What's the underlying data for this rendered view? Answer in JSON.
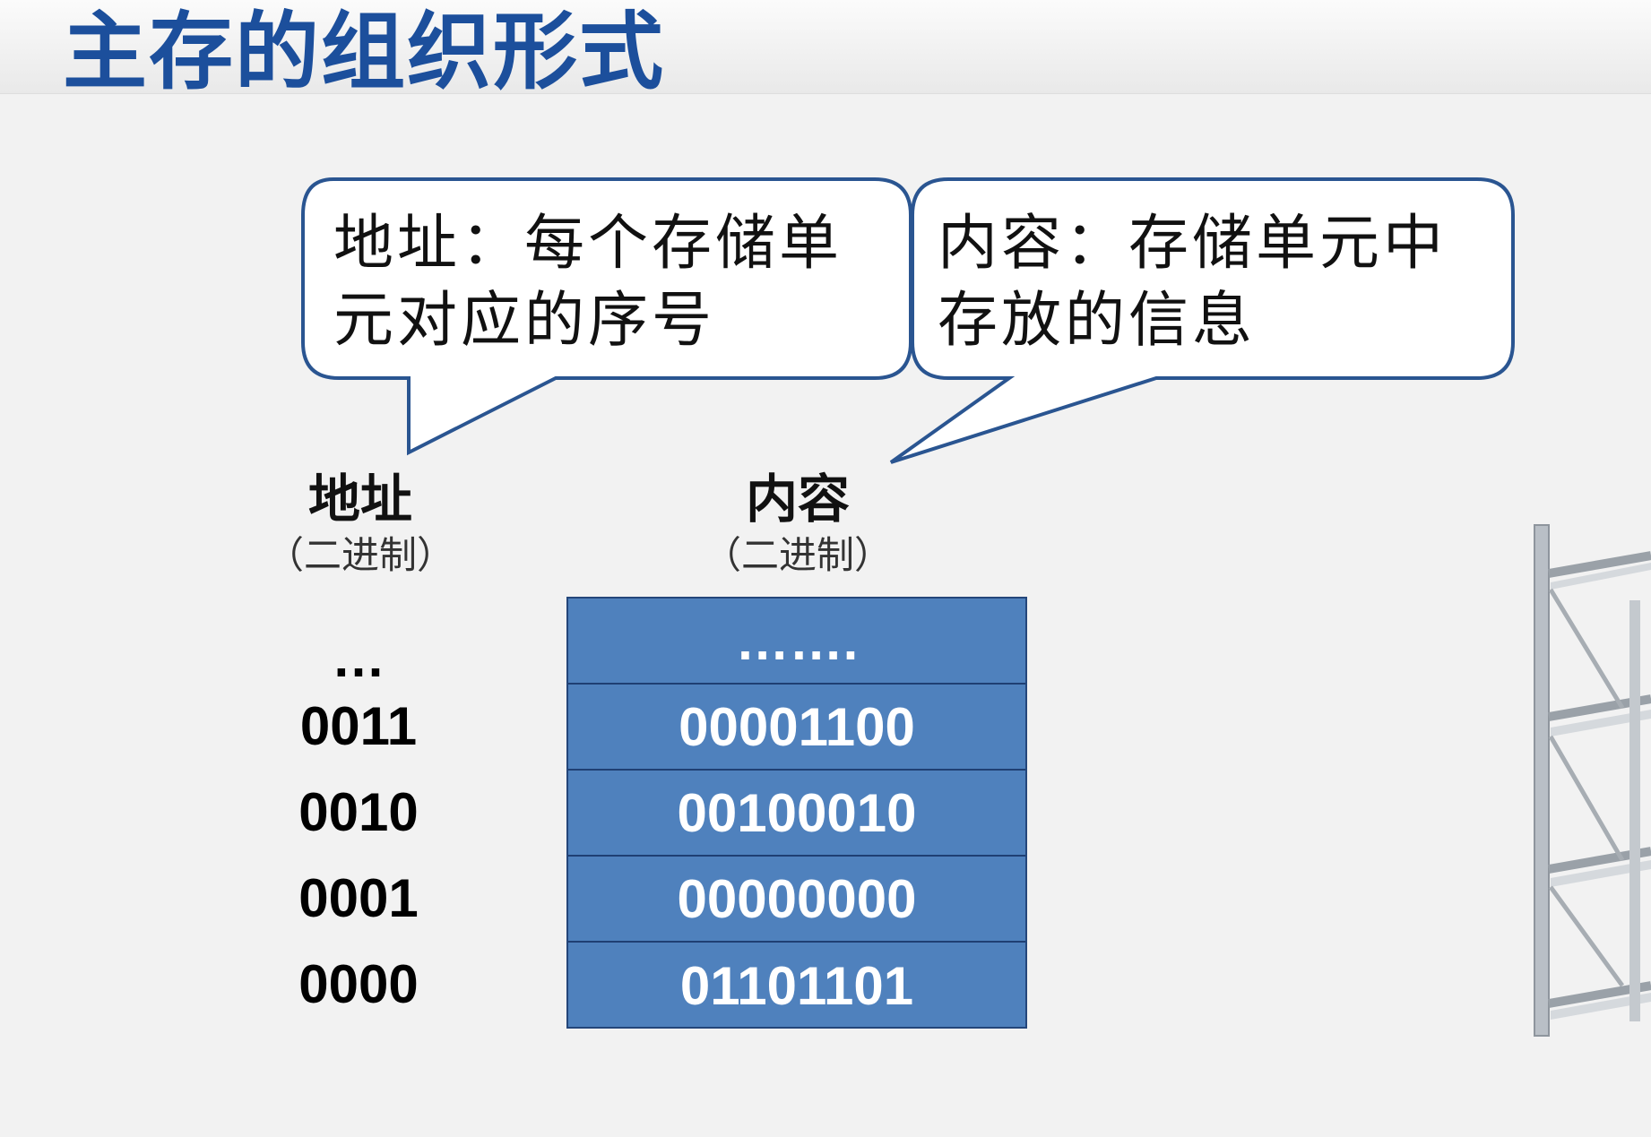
{
  "title": "主存的组织形式",
  "callouts": {
    "address": {
      "line1": "地址：每个存储单",
      "line2": "元对应的序号"
    },
    "content": {
      "line1": "内容：存储单元中",
      "line2": "存放的信息"
    }
  },
  "columns": {
    "address": {
      "label": "地址",
      "sublabel": "（二进制）"
    },
    "content": {
      "label": "内容",
      "sublabel": "（二进制）"
    }
  },
  "rows": [
    {
      "address": "…",
      "content": "……."
    },
    {
      "address": "0011",
      "content": "00001100"
    },
    {
      "address": "0010",
      "content": "00100010"
    },
    {
      "address": "0001",
      "content": "00000000"
    },
    {
      "address": "0000",
      "content": "01101101"
    }
  ],
  "colors": {
    "title": "#1c4f9c",
    "cell_fill": "#4f81bd",
    "bubble_border": "#2a5591"
  }
}
